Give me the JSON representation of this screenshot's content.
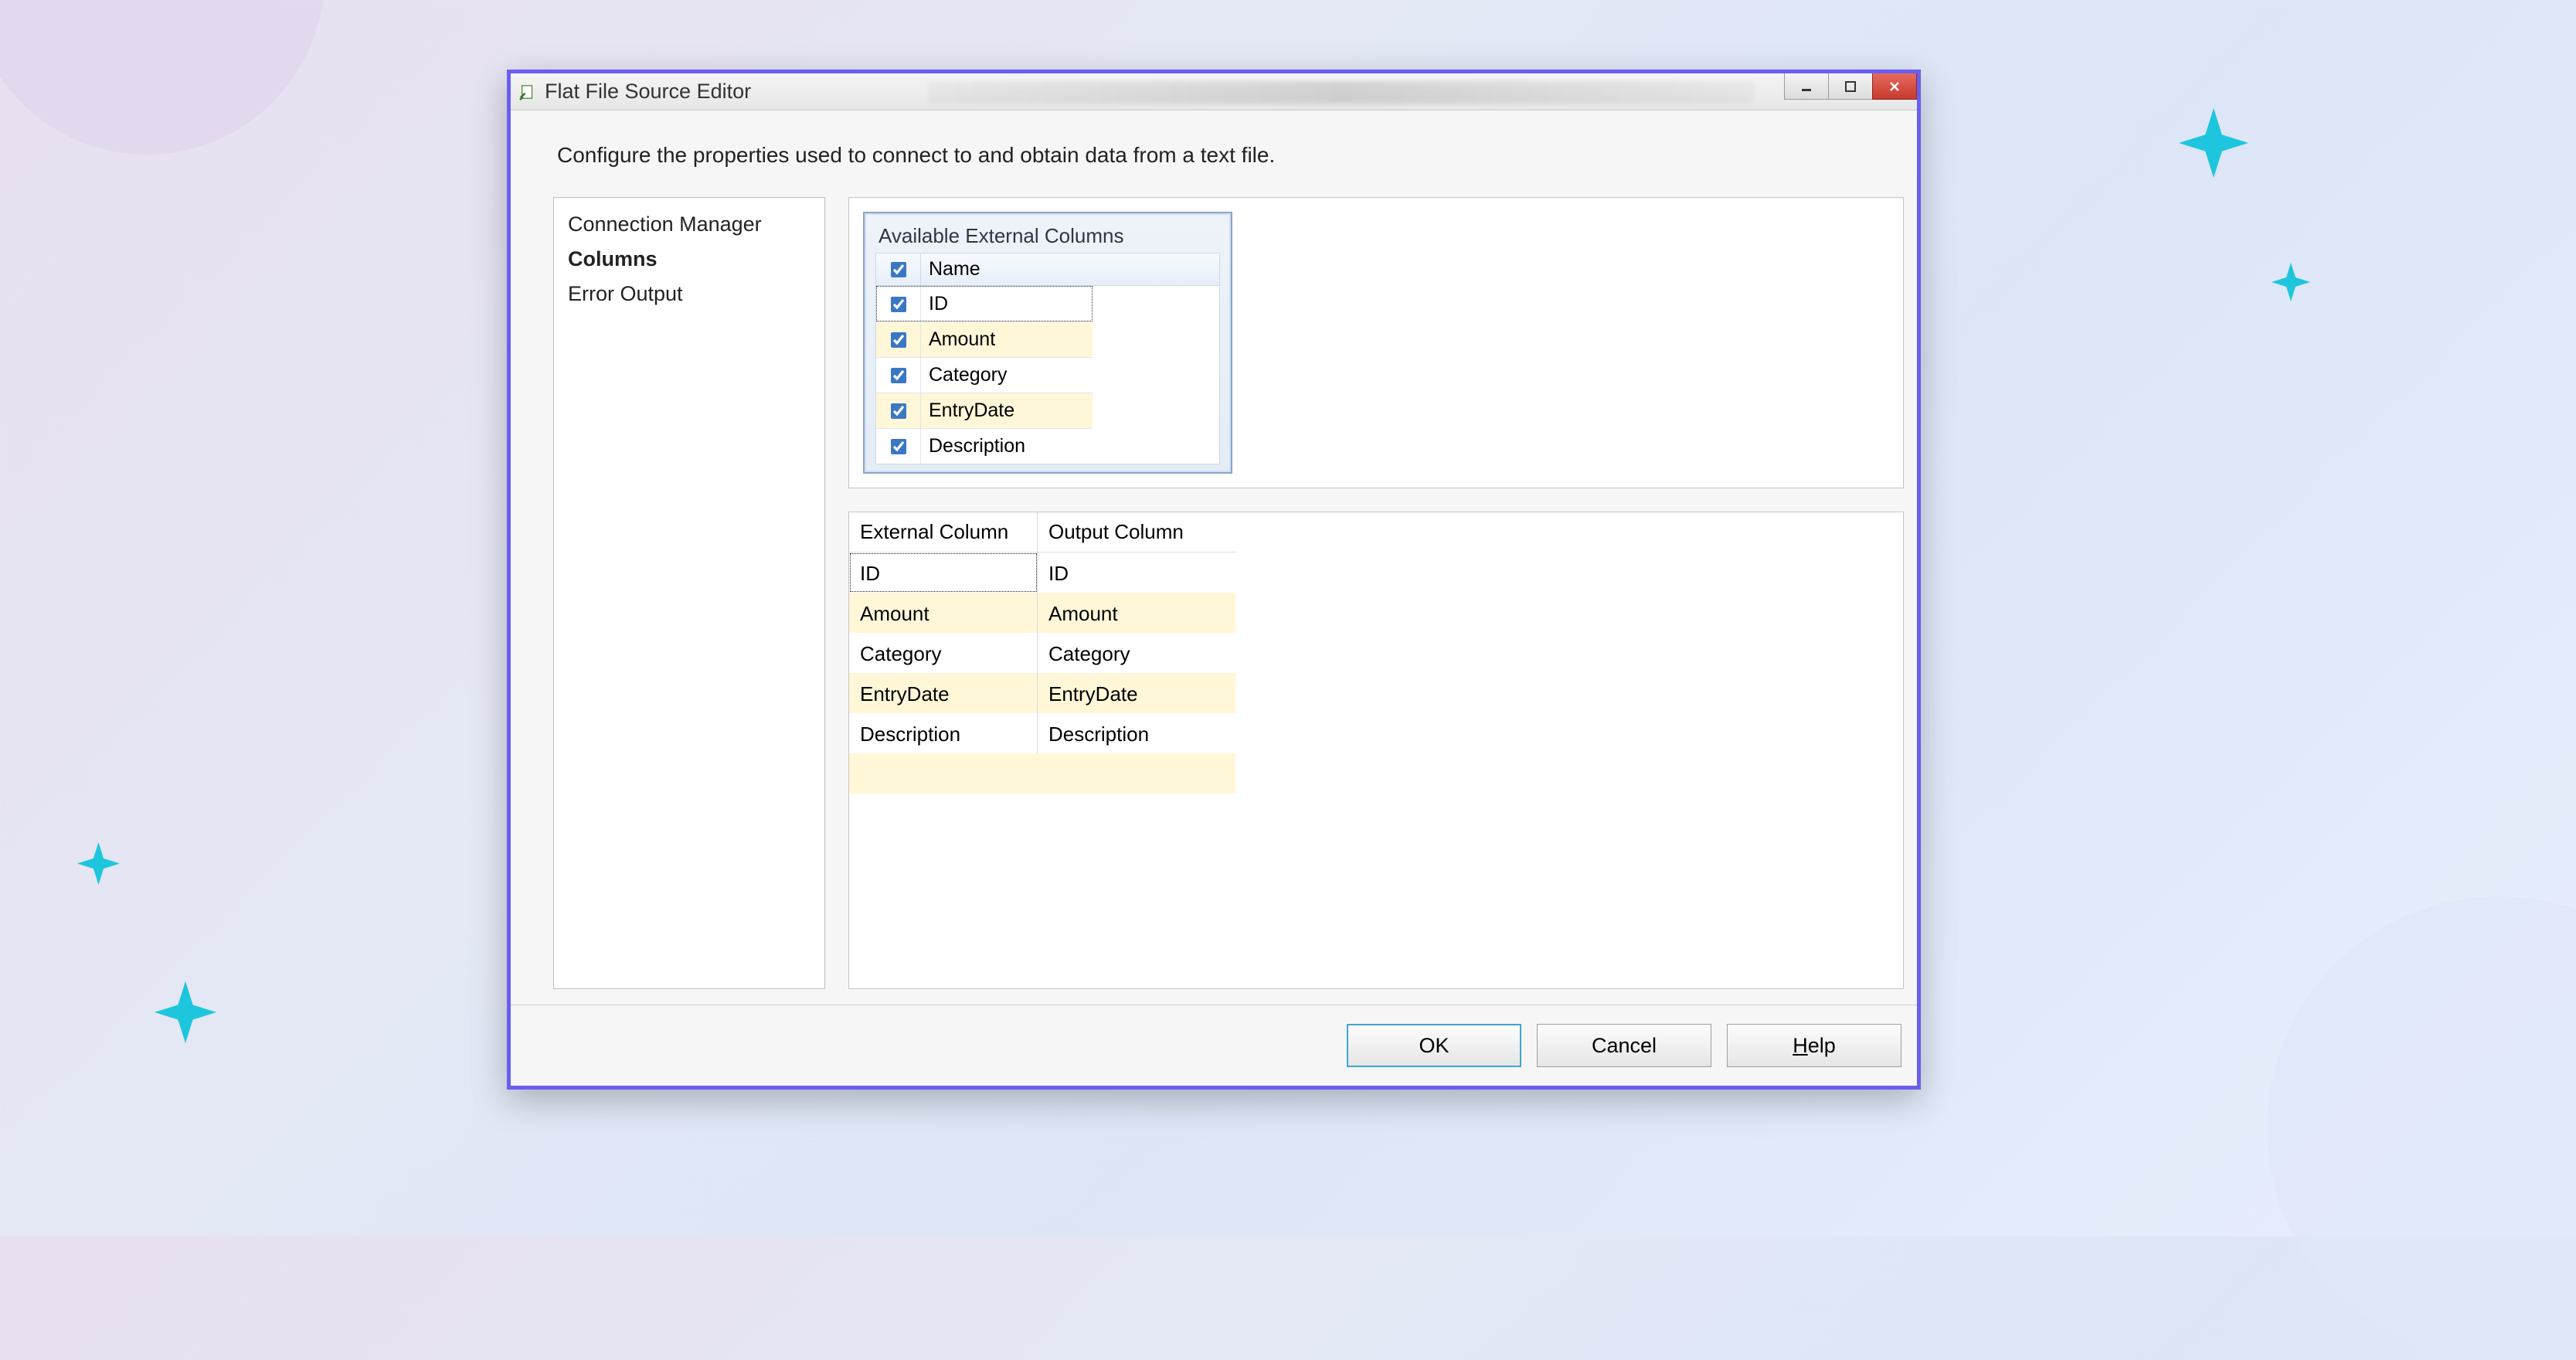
{
  "window": {
    "title": "Flat File Source Editor",
    "description": "Configure the properties used to connect to and obtain data from a text file."
  },
  "sidebar": {
    "items": [
      {
        "label": "Connection Manager",
        "selected": false
      },
      {
        "label": "Columns",
        "selected": true
      },
      {
        "label": "Error Output",
        "selected": false
      }
    ]
  },
  "available": {
    "title": "Available External Columns",
    "name_header": "Name",
    "rows": [
      {
        "label": "ID",
        "checked": true,
        "focused": true,
        "highlight": false
      },
      {
        "label": "Amount",
        "checked": true,
        "focused": false,
        "highlight": true
      },
      {
        "label": "Category",
        "checked": true,
        "focused": false,
        "highlight": false
      },
      {
        "label": "EntryDate",
        "checked": true,
        "focused": false,
        "highlight": true
      },
      {
        "label": "Description",
        "checked": true,
        "focused": false,
        "highlight": false
      }
    ]
  },
  "mapping": {
    "headers": {
      "external": "External Column",
      "output": "Output Column"
    },
    "rows": [
      {
        "external": "ID",
        "output": "ID",
        "alt": false,
        "focused": true
      },
      {
        "external": "Amount",
        "output": "Amount",
        "alt": true,
        "focused": false
      },
      {
        "external": "Category",
        "output": "Category",
        "alt": false,
        "focused": false
      },
      {
        "external": "EntryDate",
        "output": "EntryDate",
        "alt": true,
        "focused": false
      },
      {
        "external": "Description",
        "output": "Description",
        "alt": false,
        "focused": false
      }
    ]
  },
  "buttons": {
    "ok": "OK",
    "cancel": "Cancel",
    "help": "Help",
    "help_accel": "H"
  }
}
